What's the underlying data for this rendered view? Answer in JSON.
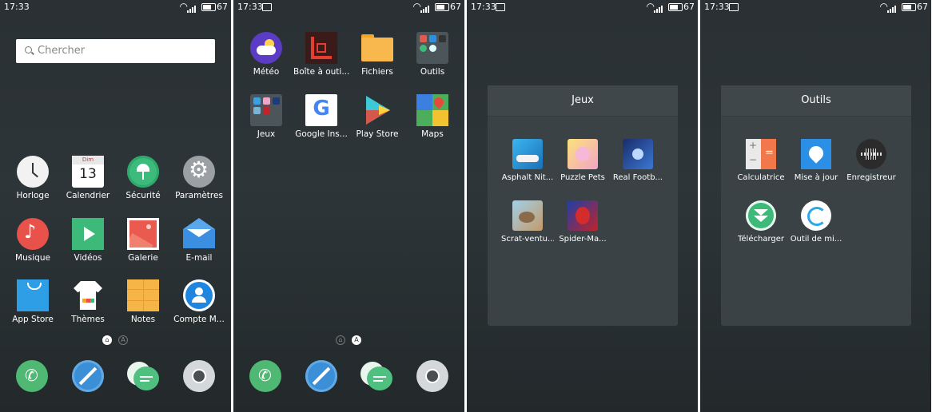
{
  "status": {
    "time": "17:33",
    "battery": "67"
  },
  "screen1": {
    "search_placeholder": "Chercher",
    "apps": [
      {
        "label": "Horloge"
      },
      {
        "label": "Calendrier",
        "day": "Dim",
        "date": "13"
      },
      {
        "label": "Sécurité"
      },
      {
        "label": "Paramètres"
      },
      {
        "label": "Musique"
      },
      {
        "label": "Vidéos"
      },
      {
        "label": "Galerie"
      },
      {
        "label": "E-mail"
      },
      {
        "label": "App Store"
      },
      {
        "label": "Thèmes"
      },
      {
        "label": "Notes"
      },
      {
        "label": "Compte M..."
      }
    ],
    "page_indicator": {
      "home_symbol": "⌂",
      "apps_letter": "A"
    }
  },
  "screen2": {
    "apps": [
      {
        "label": "Météo"
      },
      {
        "label": "Boîte à outi..."
      },
      {
        "label": "Fichiers"
      },
      {
        "label": "Outils"
      },
      {
        "label": "Jeux"
      },
      {
        "label": "Google Ins..."
      },
      {
        "label": "Play Store"
      },
      {
        "label": "Maps"
      }
    ],
    "google_letter": "G",
    "page_indicator": {
      "home_symbol": "⌂",
      "apps_letter": "A"
    }
  },
  "folder_jeux": {
    "title": "Jeux",
    "apps": [
      {
        "label": "Asphalt Nit..."
      },
      {
        "label": "Puzzle Pets"
      },
      {
        "label": "Real Footb..."
      },
      {
        "label": "Scrat-ventu..."
      },
      {
        "label": "Spider-Ma..."
      }
    ]
  },
  "folder_outils": {
    "title": "Outils",
    "apps": [
      {
        "label": "Calculatrice"
      },
      {
        "label": "Mise à jour"
      },
      {
        "label": "Enregistreur"
      },
      {
        "label": "Télécharger"
      },
      {
        "label": "Outil de mi..."
      }
    ],
    "calc_symbols": {
      "plus": "+",
      "minus": "−",
      "equals": "="
    }
  },
  "colors": {
    "phone": "#4fb873",
    "compass": "#3a8fd6",
    "chat": "#4fc07f",
    "camera": "#d5d8da",
    "accent_blue": "#2b8fe6"
  }
}
